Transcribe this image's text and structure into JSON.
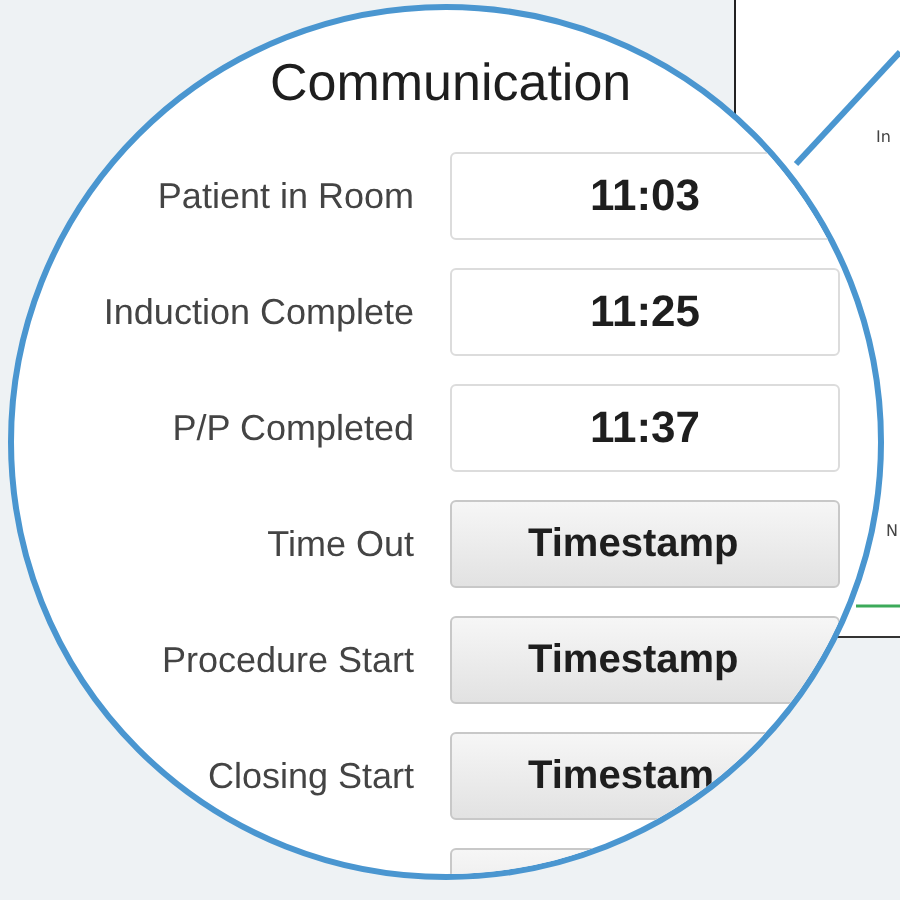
{
  "background": {
    "fragments": [
      "In",
      "N"
    ]
  },
  "magnifier": {
    "title": "Communication",
    "rows": [
      {
        "label": "Patient in Room",
        "kind": "time",
        "value": "11:03"
      },
      {
        "label": "Induction Complete",
        "kind": "time",
        "value": "11:25"
      },
      {
        "label": "P/P Completed",
        "kind": "time",
        "value": "11:37"
      },
      {
        "label": "Time Out",
        "kind": "button",
        "value": "Timestamp"
      },
      {
        "label": "Procedure Start",
        "kind": "button",
        "value": "Timestamp"
      },
      {
        "label": "Closing Start",
        "kind": "button",
        "value": "Timestam"
      },
      {
        "kind": "button"
      }
    ]
  }
}
